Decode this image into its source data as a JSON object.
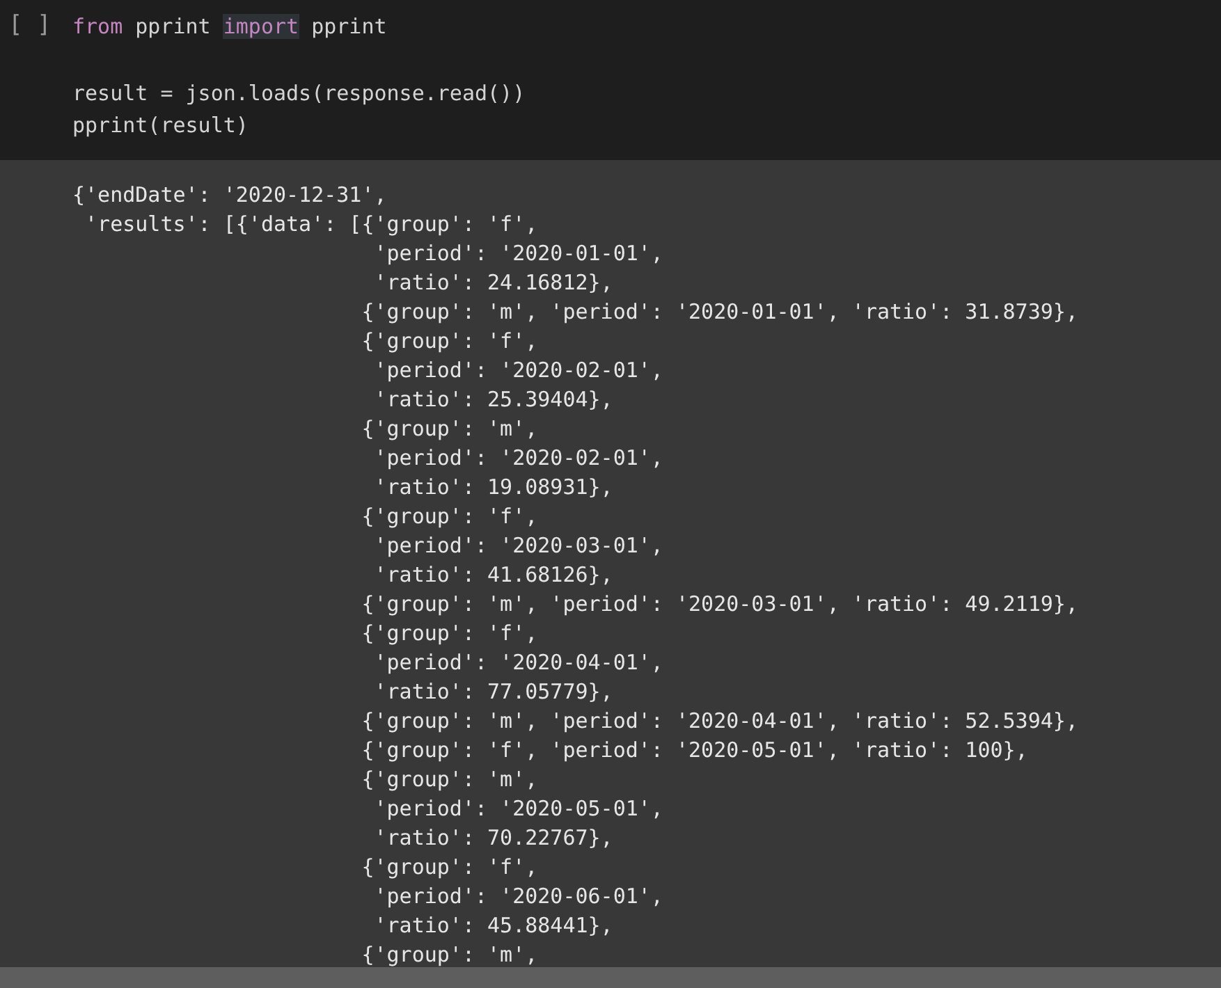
{
  "cell": {
    "run_button": "[ ]",
    "code_blocks": [
      {
        "lines": [
          {
            "tokens": [
              {
                "text": "from",
                "kind": "keyword",
                "highlighted": false
              },
              {
                "text": " pprint ",
                "kind": "plain",
                "highlighted": false
              },
              {
                "text": "import",
                "kind": "keyword",
                "highlighted": true
              },
              {
                "text": " pprint",
                "kind": "plain",
                "highlighted": false
              }
            ]
          }
        ]
      },
      {
        "lines": [
          {
            "tokens": [
              {
                "text": "result = json.loads(response.read())",
                "kind": "plain",
                "highlighted": false
              }
            ]
          },
          {
            "tokens": [
              {
                "text": "pprint(result)",
                "kind": "plain",
                "highlighted": false
              }
            ]
          }
        ]
      }
    ],
    "output_lines": [
      "{'endDate': '2020-12-31',",
      " 'results': [{'data': [{'group': 'f',",
      "                        'period': '2020-01-01',",
      "                        'ratio': 24.16812},",
      "                       {'group': 'm', 'period': '2020-01-01', 'ratio': 31.8739},",
      "                       {'group': 'f',",
      "                        'period': '2020-02-01',",
      "                        'ratio': 25.39404},",
      "                       {'group': 'm',",
      "                        'period': '2020-02-01',",
      "                        'ratio': 19.08931},",
      "                       {'group': 'f',",
      "                        'period': '2020-03-01',",
      "                        'ratio': 41.68126},",
      "                       {'group': 'm', 'period': '2020-03-01', 'ratio': 49.2119},",
      "                       {'group': 'f',",
      "                        'period': '2020-04-01',",
      "                        'ratio': 77.05779},",
      "                       {'group': 'm', 'period': '2020-04-01', 'ratio': 52.5394},",
      "                       {'group': 'f', 'period': '2020-05-01', 'ratio': 100},",
      "                       {'group': 'm',",
      "                        'period': '2020-05-01',",
      "                        'ratio': 70.22767},",
      "                       {'group': 'f',",
      "                        'period': '2020-06-01',",
      "                        'ratio': 45.88441},",
      "                       {'group': 'm',"
    ]
  }
}
